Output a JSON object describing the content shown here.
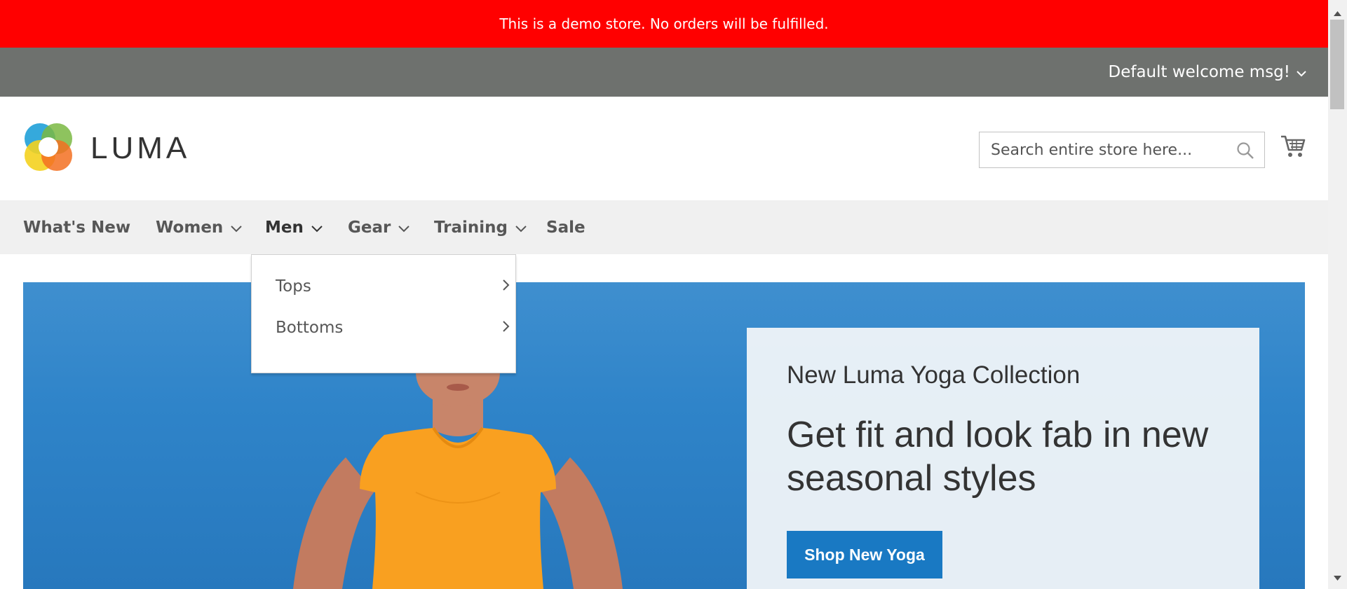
{
  "demo_notice": "This is a demo store. No orders will be fulfilled.",
  "header_panel": {
    "welcome_message": "Default welcome msg!"
  },
  "logo": {
    "text": "LUMA"
  },
  "search": {
    "placeholder": "Search entire store here..."
  },
  "nav": {
    "items": [
      {
        "label": "What's New",
        "has_dropdown": false
      },
      {
        "label": "Women",
        "has_dropdown": true
      },
      {
        "label": "Men",
        "has_dropdown": true,
        "active": true
      },
      {
        "label": "Gear",
        "has_dropdown": true
      },
      {
        "label": "Training",
        "has_dropdown": true
      },
      {
        "label": "Sale",
        "has_dropdown": false
      }
    ]
  },
  "men_dropdown": {
    "items": [
      {
        "label": "Tops"
      },
      {
        "label": "Bottoms"
      }
    ]
  },
  "hero": {
    "subtitle": "New Luma Yoga Collection",
    "title": "Get fit and look fab in new seasonal styles",
    "button_label": "Shop New Yoga"
  },
  "colors": {
    "demo_banner": "#ff0000",
    "header_panel": "#6e716e",
    "nav_background": "#f0f0f0",
    "primary_button": "#1979c3",
    "hero_background": "#2f84c9",
    "shirt": "#f9a020"
  },
  "icons": [
    "chevron-down-icon",
    "search-icon",
    "cart-icon",
    "chevron-right-icon",
    "luma-logo-icon"
  ]
}
